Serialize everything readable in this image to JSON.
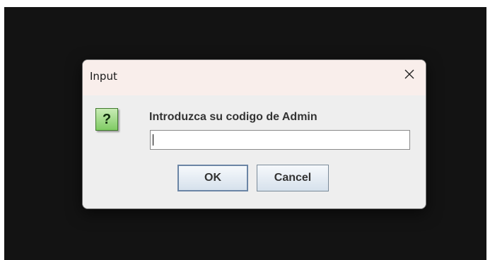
{
  "dialog": {
    "title": "Input",
    "close_icon": "close-icon",
    "message_icon": "question-icon",
    "message_icon_glyph": "?",
    "prompt": "Introduzca su codigo de Admin",
    "input_value": "",
    "buttons": {
      "ok_label": "OK",
      "cancel_label": "Cancel"
    }
  },
  "colors": {
    "backdrop": "#131313",
    "titlebar": "#f9eeeb",
    "dialog_body": "#eeeeee",
    "icon_green": "#7fcb63"
  }
}
